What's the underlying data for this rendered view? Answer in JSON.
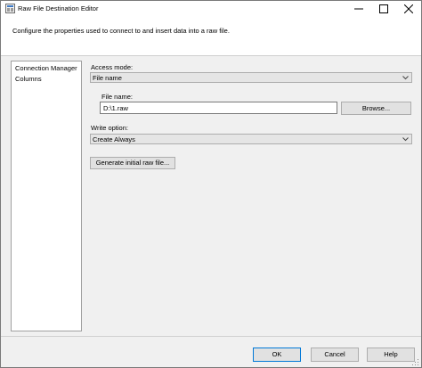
{
  "window": {
    "title": "Raw File Destination Editor"
  },
  "header": {
    "description": "Configure the properties used to connect to and insert data into a raw file."
  },
  "nav": {
    "items": [
      {
        "label": "Connection Manager"
      },
      {
        "label": "Columns"
      }
    ]
  },
  "form": {
    "access_mode_label": "Access mode:",
    "access_mode_value": "File name",
    "file_name_label": "File name:",
    "file_name_value": "D:\\1.raw",
    "browse_label": "Browse...",
    "write_option_label": "Write option:",
    "write_option_value": "Create Always",
    "generate_label": "Generate initial raw file..."
  },
  "footer": {
    "ok_label": "OK",
    "cancel_label": "Cancel",
    "help_label": "Help"
  },
  "colors": {
    "window_bg": "#f0f0f0",
    "primary_border": "#0078d7"
  }
}
